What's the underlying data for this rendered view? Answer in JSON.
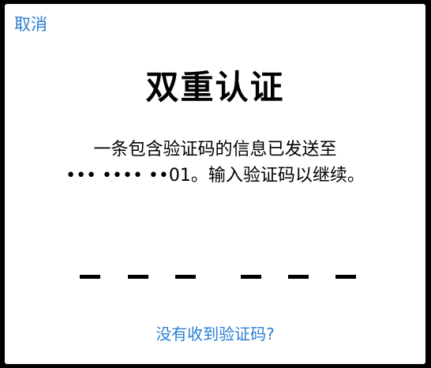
{
  "dialog": {
    "cancel_label": "取消",
    "title": "双重认证",
    "message_line1": "一条包含验证码的信息已发送至",
    "message_line2": "••• •••• ••01。输入验证码以继续。",
    "resend_label": "没有收到验证码?"
  },
  "code_input": {
    "slots": [
      "",
      "",
      "",
      "",
      "",
      ""
    ]
  },
  "colors": {
    "accent": "#2a7fd4",
    "text": "#000000",
    "background": "#ffffff"
  }
}
